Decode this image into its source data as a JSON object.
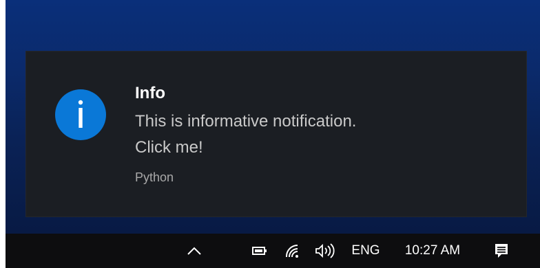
{
  "notification": {
    "title": "Info",
    "message_line1": "This is informative notification.",
    "message_line2": "Click me!",
    "source": "Python",
    "icon": "info-icon",
    "accent_color": "#0a78d7"
  },
  "taskbar": {
    "language": "ENG",
    "time": "10:27 AM",
    "icons": [
      "chevron-up-icon",
      "battery-icon",
      "wifi-icon",
      "volume-icon",
      "action-center-icon"
    ]
  }
}
